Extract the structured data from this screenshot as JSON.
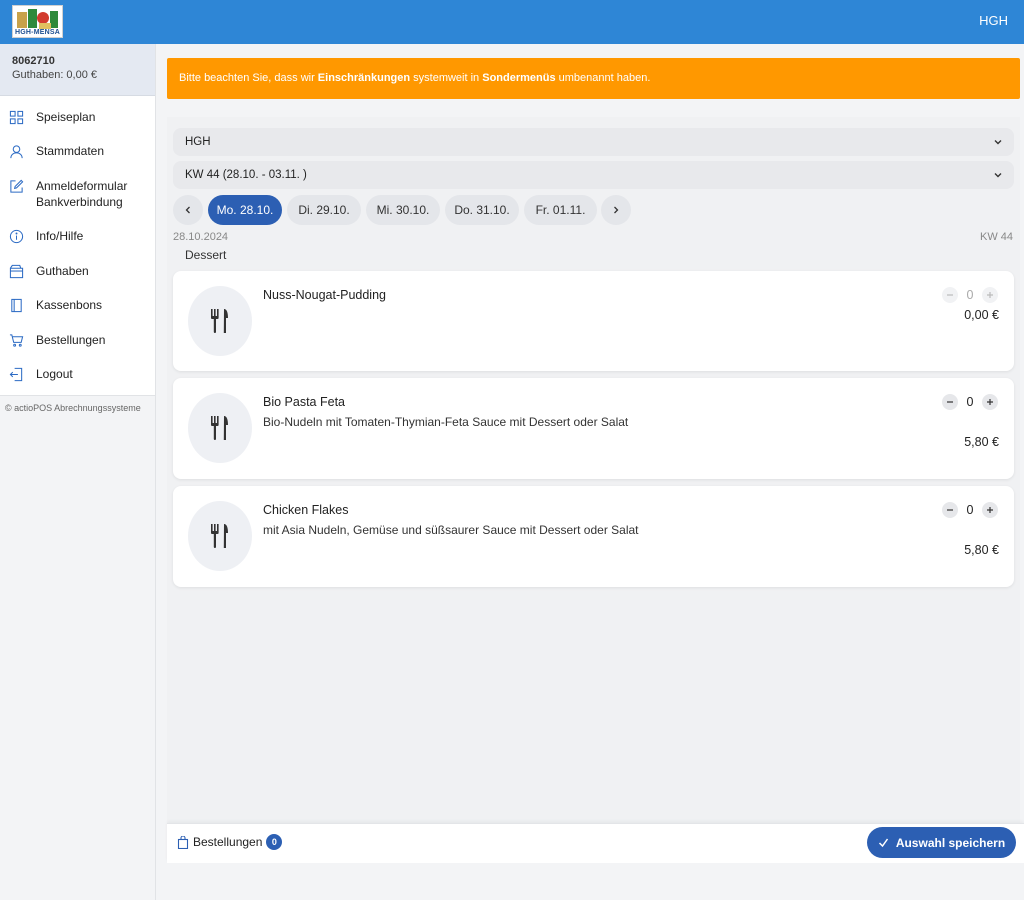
{
  "header": {
    "logo_text": "HGH-MENSA",
    "user": "HGH"
  },
  "account": {
    "id": "8062710",
    "balance": "Guthaben: 0,00 €"
  },
  "sidebar": {
    "items": [
      {
        "label": "Speiseplan",
        "icon": "grid-icon"
      },
      {
        "label": "Stammdaten",
        "icon": "user-icon"
      },
      {
        "label": "Anmeldeformular\nBankverbindung",
        "icon": "edit-icon"
      },
      {
        "label": "Info/Hilfe",
        "icon": "info-icon"
      },
      {
        "label": "Guthaben",
        "icon": "wallet-icon"
      },
      {
        "label": "Kassenbons",
        "icon": "receipt-book-icon"
      },
      {
        "label": "Bestellungen",
        "icon": "cart-icon"
      },
      {
        "label": "Logout",
        "icon": "logout-icon"
      }
    ],
    "copyright": "© actioPOS Abrechnungssysteme"
  },
  "notice": {
    "part1": "Bitte beachten Sie, dass wir ",
    "bold1": "Einschränkungen",
    "part2": " systemweit in ",
    "bold2": "Sondermenüs",
    "part3": " umbenannt haben."
  },
  "location_select": {
    "value": "HGH"
  },
  "week_select": {
    "value": "KW 44 (28.10. - 03.11. )"
  },
  "days": [
    {
      "label": "Mo. 28.10.",
      "active": true
    },
    {
      "label": "Di. 29.10.",
      "active": false
    },
    {
      "label": "Mi. 30.10.",
      "active": false
    },
    {
      "label": "Do. 31.10.",
      "active": false
    },
    {
      "label": "Fr. 01.11.",
      "active": false
    }
  ],
  "date_label": "28.10.2024",
  "week_label": "KW 44",
  "category": "Dessert",
  "menu_items": [
    {
      "title": "Nuss-Nougat-Pudding",
      "description": "",
      "qty": "0",
      "price": "0,00 €",
      "enabled": false
    },
    {
      "title": "Bio Pasta Feta",
      "description": "Bio-Nudeln mit Tomaten-Thymian-Feta Sauce mit Dessert oder Salat",
      "qty": "0",
      "price": "5,80 €",
      "enabled": true
    },
    {
      "title": "Chicken Flakes",
      "description": "mit Asia Nudeln, Gemüse und süßsaurer Sauce mit Dessert oder Salat",
      "qty": "0",
      "price": "5,80 €",
      "enabled": true
    }
  ],
  "bottom": {
    "orders_label": "Bestellungen",
    "orders_count": "0",
    "save_label": "Auswahl speichern"
  },
  "colors": {
    "header": "#2e86d6",
    "notice": "#ff9800",
    "accent": "#2c5fb3"
  }
}
